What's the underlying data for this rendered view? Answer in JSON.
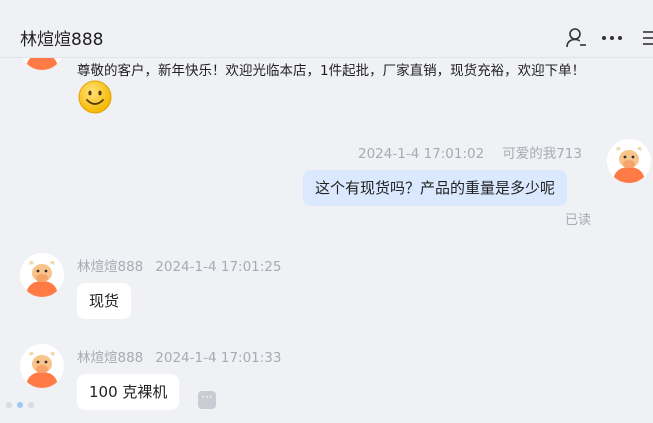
{
  "header": {
    "title": "林煊煊888",
    "icons": [
      "user-icon",
      "more-icon",
      "sidebar-toggle-icon"
    ]
  },
  "messages": [
    {
      "id": "welcome",
      "direction": "incoming",
      "text": "尊敬的客户，新年快乐！欢迎光临本店，1件起批，厂家直销，现货充裕，欢迎下单！",
      "emoji": "smile-emoji"
    },
    {
      "id": "m1",
      "direction": "outgoing",
      "sender": "可爱的我713",
      "timestamp": "2024-1-4 17:01:02",
      "text": "这个有现货吗？产品的重量是多少呢",
      "status": "已读"
    },
    {
      "id": "m2",
      "direction": "incoming",
      "sender": "林煊煊888",
      "timestamp": "2024-1-4 17:01:25",
      "text": "现货"
    },
    {
      "id": "m3",
      "direction": "incoming",
      "sender": "林煊煊888",
      "timestamp": "2024-1-4 17:01:33",
      "text": "100 克裸机"
    }
  ],
  "colors": {
    "background": "#f0f1f5",
    "bubble_in": "#ffffff",
    "bubble_out": "#dbe9ff",
    "meta_text": "#a8abb3",
    "avatar_orange": "#ff7a45"
  }
}
